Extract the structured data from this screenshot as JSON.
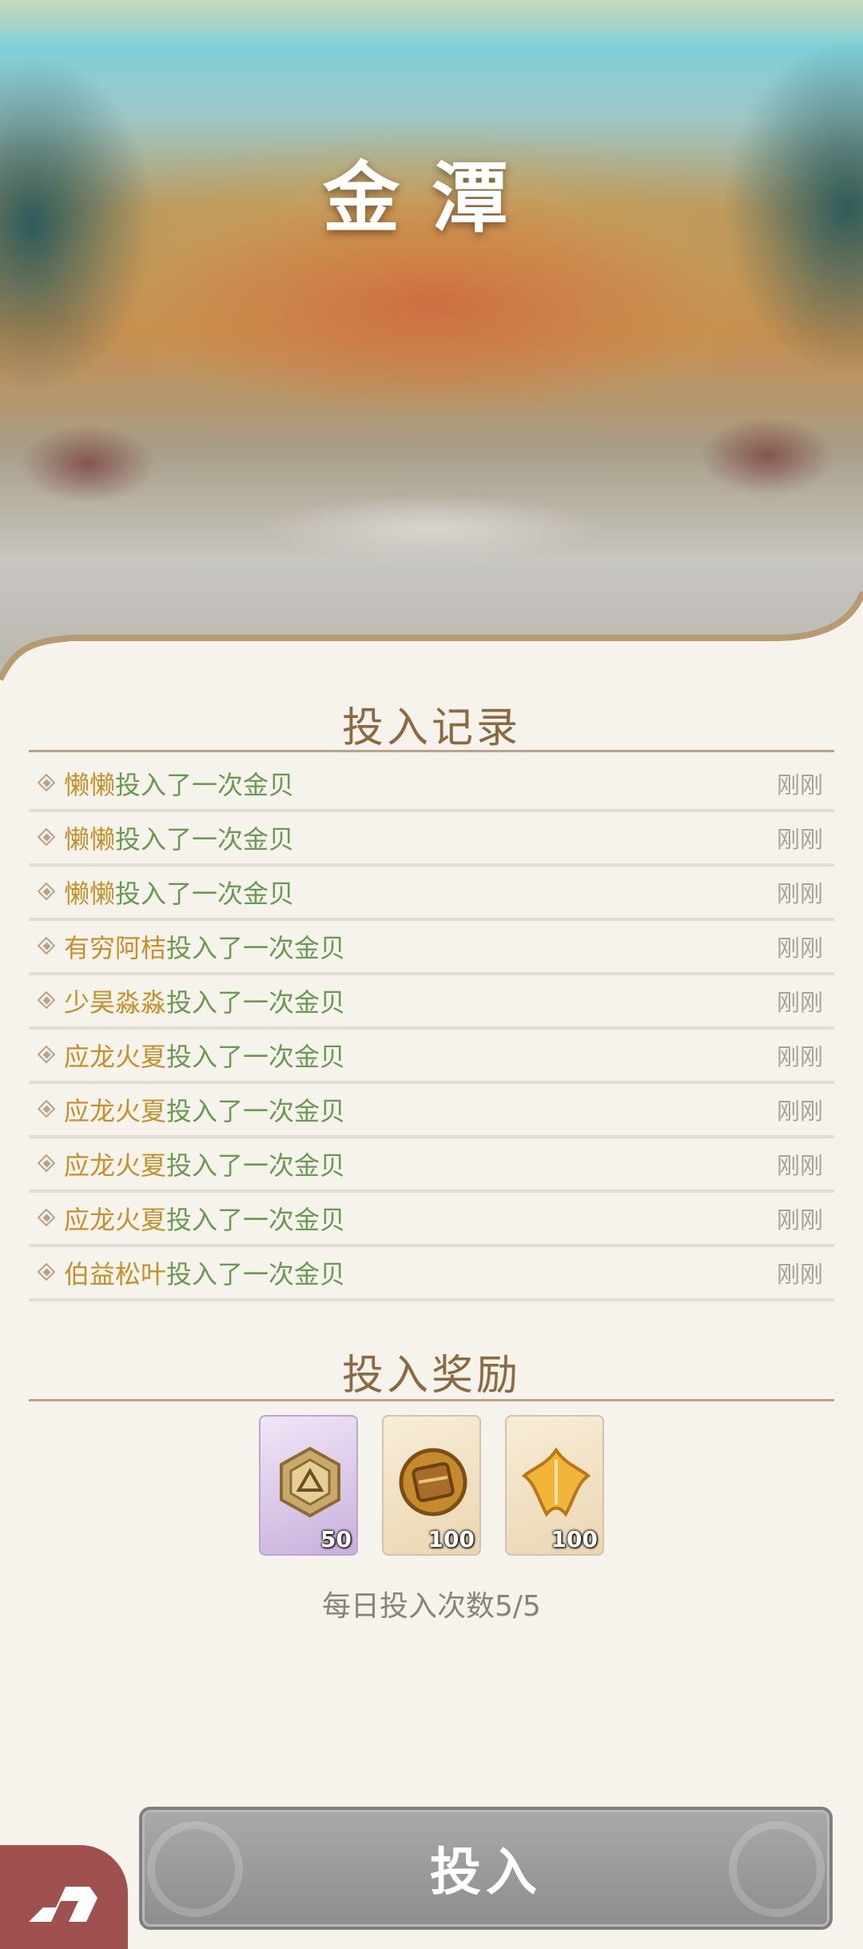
{
  "hero": {
    "title": "金潭"
  },
  "records": {
    "title": "投入记录",
    "items": [
      {
        "name": "懒懒",
        "action": "投入了一次金贝",
        "time": "刚刚"
      },
      {
        "name": "懒懒",
        "action": "投入了一次金贝",
        "time": "刚刚"
      },
      {
        "name": "懒懒",
        "action": "投入了一次金贝",
        "time": "刚刚"
      },
      {
        "name": "有穷阿桔",
        "action": "投入了一次金贝",
        "time": "刚刚"
      },
      {
        "name": "少昊淼淼",
        "action": "投入了一次金贝",
        "time": "刚刚"
      },
      {
        "name": "应龙火夏",
        "action": "投入了一次金贝",
        "time": "刚刚"
      },
      {
        "name": "应龙火夏",
        "action": "投入了一次金贝",
        "time": "刚刚"
      },
      {
        "name": "应龙火夏",
        "action": "投入了一次金贝",
        "time": "刚刚"
      },
      {
        "name": "应龙火夏",
        "action": "投入了一次金贝",
        "time": "刚刚"
      },
      {
        "name": "伯益松叶",
        "action": "投入了一次金贝",
        "time": "刚刚"
      }
    ]
  },
  "rewards": {
    "title": "投入奖励",
    "items": [
      {
        "icon": "coin-emblem-icon",
        "count": "50",
        "bg": "purple"
      },
      {
        "icon": "wood-shield-icon",
        "count": "100",
        "bg": "gold"
      },
      {
        "icon": "gold-leaf-icon",
        "count": "100",
        "bg": "gold"
      }
    ]
  },
  "daily_limit": "每日投入次数5/5",
  "submit_label": "投入",
  "colors": {
    "name": "#c4912a",
    "action": "#6a9a52",
    "title": "#8b6a42",
    "button": "#9b9b9b",
    "corner": "#a15050"
  }
}
